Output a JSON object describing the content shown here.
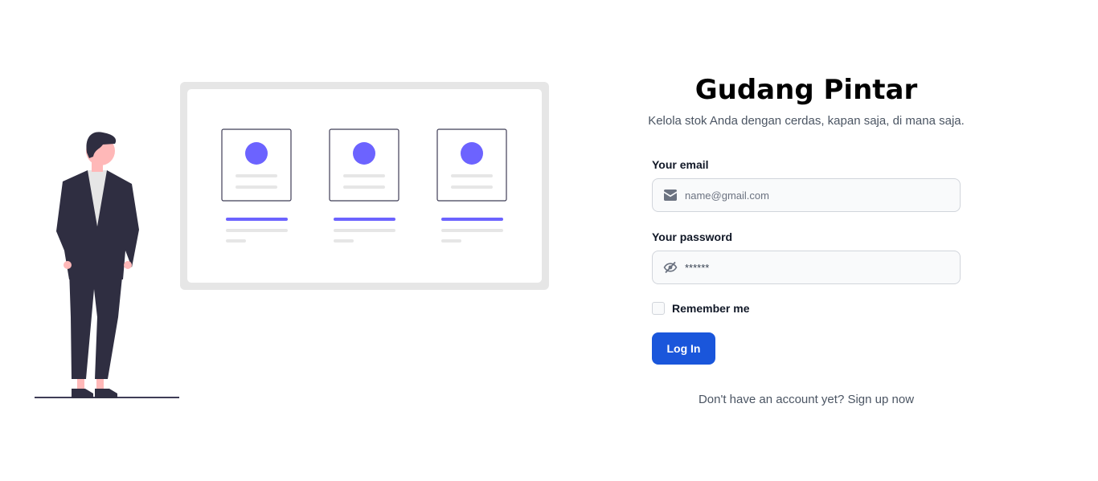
{
  "app": {
    "title": "Gudang Pintar",
    "subtitle": "Kelola stok Anda dengan cerdas, kapan saja, di mana saja."
  },
  "form": {
    "email_label": "Your email",
    "email_placeholder": "name@gmail.com",
    "email_icon": "envelope-icon",
    "password_label": "Your password",
    "password_value": "******",
    "password_icon": "eye-slash-icon",
    "remember_label": "Remember me",
    "remember_checked": false,
    "login_label": "Log In"
  },
  "signup": {
    "prompt": "Don't have an account yet?",
    "link_label": "Sign up now"
  },
  "colors": {
    "primary": "#1a56db",
    "accent_purple": "#6c63ff",
    "figure_dark": "#2f2e41",
    "skin": "#ffb8b8"
  }
}
